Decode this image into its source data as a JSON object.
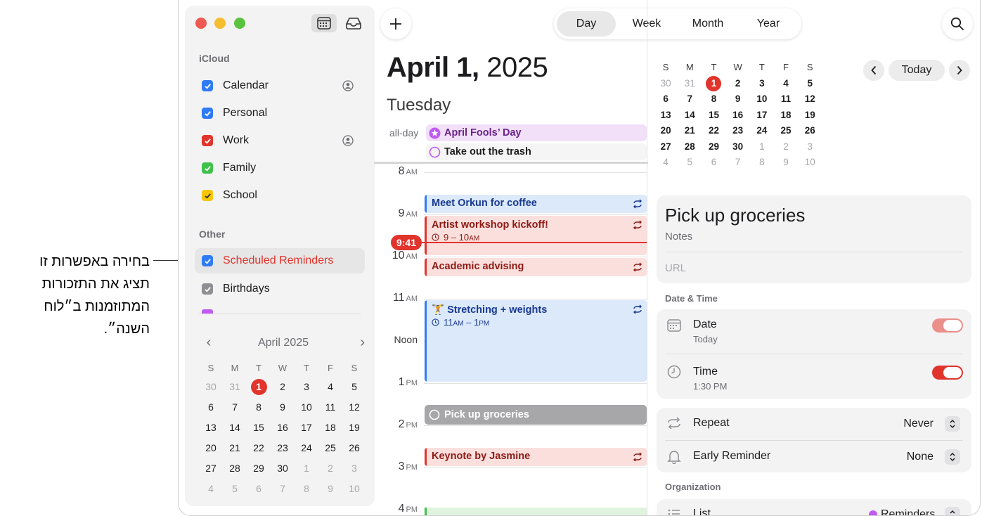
{
  "callout": {
    "line1": "בחירה באפשרות זו",
    "line2": "תציג את התזכורות",
    "line3": "המתוזמנות ב״לוח",
    "line4": "השנה״."
  },
  "sidebar": {
    "icloud_header": "iCloud",
    "other_header": "Other",
    "calendars": [
      {
        "label": "Calendar",
        "color": "#2f7bf5"
      },
      {
        "label": "Personal",
        "color": "#2f7bf5"
      },
      {
        "label": "Work",
        "color": "#e0342c"
      },
      {
        "label": "Family",
        "color": "#40c04a"
      },
      {
        "label": "School",
        "color": "#f7c600"
      }
    ],
    "other": [
      {
        "label": "Scheduled Reminders",
        "color": "#2f7bf5"
      },
      {
        "label": "Birthdays",
        "color": "#8e8e93"
      }
    ],
    "mini_month": {
      "title": "April 2025",
      "dows": [
        "S",
        "M",
        "T",
        "W",
        "T",
        "F",
        "S"
      ],
      "weeks": [
        [
          "30",
          "31",
          "1",
          "2",
          "3",
          "4",
          "5"
        ],
        [
          "6",
          "7",
          "8",
          "9",
          "10",
          "11",
          "12"
        ],
        [
          "13",
          "14",
          "15",
          "16",
          "17",
          "18",
          "19"
        ],
        [
          "20",
          "21",
          "22",
          "23",
          "24",
          "25",
          "26"
        ],
        [
          "27",
          "28",
          "29",
          "30",
          "1",
          "2",
          "3"
        ],
        [
          "4",
          "5",
          "6",
          "7",
          "8",
          "9",
          "10"
        ]
      ]
    }
  },
  "toolbar": {
    "add_label": "+",
    "views": [
      "Day",
      "Week",
      "Month",
      "Year"
    ],
    "active_view": "Day"
  },
  "day": {
    "date_bold": "April 1,",
    "year": "2025",
    "weekday": "Tuesday",
    "allday_label": "all-day",
    "allday_events": [
      "April Fools’ Day",
      "Take out the trash"
    ],
    "hours": [
      {
        "num": "8",
        "suffix": "AM"
      },
      {
        "num": "9",
        "suffix": "AM"
      },
      {
        "num": "10",
        "suffix": "AM"
      },
      {
        "num": "11",
        "suffix": "AM"
      },
      {
        "num": "Noon",
        "suffix": ""
      },
      {
        "num": "1",
        "suffix": "PM"
      },
      {
        "num": "2",
        "suffix": "PM"
      },
      {
        "num": "3",
        "suffix": "PM"
      },
      {
        "num": "4",
        "suffix": "PM"
      }
    ],
    "events": {
      "coffee": "Meet Orkun for coffee",
      "workshop": "Artist workshop kickoff!",
      "workshop_time_a": "9 – 10",
      "workshop_time_b": "AM",
      "advising": "Academic advising",
      "stretching": "🏋 Stretching + weights",
      "stretching_time_a": "11",
      "stretching_time_b": "AM",
      "stretching_time_c": " – 1",
      "stretching_time_d": "PM",
      "groceries": "Pick up groceries",
      "keynote": "Keynote by Jasmine"
    },
    "now": "9:41"
  },
  "right": {
    "today_label": "Today",
    "mini": {
      "dows": [
        "S",
        "M",
        "T",
        "W",
        "T",
        "F",
        "S"
      ],
      "weeks": [
        [
          "30",
          "31",
          "1",
          "2",
          "3",
          "4",
          "5"
        ],
        [
          "6",
          "7",
          "8",
          "9",
          "10",
          "11",
          "12"
        ],
        [
          "13",
          "14",
          "15",
          "16",
          "17",
          "18",
          "19"
        ],
        [
          "20",
          "21",
          "22",
          "23",
          "24",
          "25",
          "26"
        ],
        [
          "27",
          "28",
          "29",
          "30",
          "1",
          "2",
          "3"
        ],
        [
          "4",
          "5",
          "6",
          "7",
          "8",
          "9",
          "10"
        ]
      ]
    },
    "detail": {
      "title": "Pick up groceries",
      "notes": "Notes",
      "url": "URL",
      "datetime_header": "Date & Time",
      "date_label": "Date",
      "date_sub": "Today",
      "time_label": "Time",
      "time_sub": "1:30 PM",
      "repeat_label": "Repeat",
      "repeat_value": "Never",
      "early_label": "Early Reminder",
      "early_value": "None",
      "org_header": "Organization",
      "list_label": "List",
      "list_value": "Reminders"
    }
  }
}
